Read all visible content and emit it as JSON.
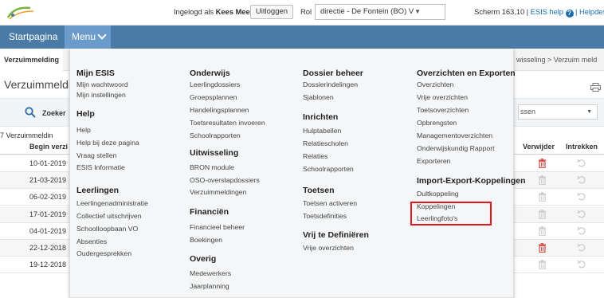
{
  "topbar": {
    "logged_in_prefix": "Ingelogd als",
    "user_name": "Kees Meester",
    "logout_label": "Uitloggen",
    "role_label": "Rol",
    "role_value": "directie - De Fontein (BO) V",
    "version": "Scherm 163.10 |",
    "esis_help": "ESIS help",
    "helpdesk": "| Helpdesk"
  },
  "nav": {
    "start": "Startpagina",
    "menu": "Menu"
  },
  "page": {
    "tab_label": "Verzuimmelding",
    "breadcrumb_right": "wisseling > Verzuim meld",
    "title": "Verzuimmeldi",
    "search_label": "Zoeker",
    "filter_value": "ssen",
    "count_text": "7 Verzuimmeldin",
    "columns": {
      "begin": "Begin verzi",
      "verwijder": "Verwijder",
      "intrekken": "Intrekken"
    },
    "rows": [
      {
        "date": "10-01-2019",
        "trash_active": true
      },
      {
        "date": "21-03-2019",
        "trash_active": false
      },
      {
        "date": "06-02-2019",
        "trash_active": false
      },
      {
        "date": "17-01-2019",
        "trash_active": false
      },
      {
        "date": "04-01-2019",
        "trash_active": false
      },
      {
        "date": "22-12-2018",
        "trash_active": true
      },
      {
        "date": "19-12-2018",
        "trash_active": false
      }
    ]
  },
  "megamenu": {
    "col1": {
      "sec1": {
        "title": "Mijn ESIS",
        "items": [
          "Mijn wachtwoord",
          "Mijn instellingen"
        ]
      },
      "sec2": {
        "title": "Help",
        "items": [
          "Help",
          "Help bij deze pagina",
          "Vraag stellen",
          "ESIS Informatie"
        ]
      },
      "sec3": {
        "title": "Leerlingen",
        "items": [
          "Leerlingenadministratie",
          "Collectief uitschrijven",
          "Schoolloopbaan VO",
          "Absenties",
          "Oudergesprekken"
        ]
      }
    },
    "col2": {
      "sec1": {
        "title": "Onderwijs",
        "items": [
          "Leerlingdossiers",
          "Groepsplannen",
          "Handelingsplannen",
          "Toetsresultaten invoeren",
          "Schoolrapporten"
        ]
      },
      "sec2": {
        "title": "Uitwisseling",
        "items": [
          "BRON module",
          "OSO-overstapdossiers",
          "Verzuimmeldingen"
        ]
      },
      "sec3": {
        "title": "Financiën",
        "items": [
          "Financieel beheer",
          "Boekingen"
        ]
      },
      "sec4": {
        "title": "Overig",
        "items": [
          "Medewerkers",
          "Jaarplanning"
        ]
      }
    },
    "col3": {
      "sec1": {
        "title": "Dossier beheer",
        "items": [
          "Dossierindelingen",
          "Sjablonen"
        ]
      },
      "sec2": {
        "title": "Inrichten",
        "items": [
          "Hulptabellen",
          "Relatiescholen",
          "Relaties",
          "Schoolrapporten"
        ]
      },
      "sec3": {
        "title": "Toetsen",
        "items": [
          "Toetsen activeren",
          "Toetsdefinities"
        ]
      },
      "sec4": {
        "title": "Vrij te Definiëren",
        "items": [
          "Vrije overzichten"
        ]
      }
    },
    "col4": {
      "sec1": {
        "title": "Overzichten en Exporten",
        "items": [
          "Overzichten",
          "Vrije overzichten",
          "Toetsoverzichten",
          "Opbrengsten",
          "Managementoverzichten",
          "Onderwijskundig Rapport",
          "Exporteren"
        ]
      },
      "sec2": {
        "title": "Import-Export-Koppelingen",
        "items": [
          "Dultkoppeling",
          "Koppelingen",
          "Leerlingfoto's"
        ]
      }
    }
  },
  "colors": {
    "navbar": "#4a7ba7",
    "menu_active": "#6b9bcb",
    "highlight": "#e0161e",
    "link": "#1a6fb0",
    "trash_active": "#d9534f"
  }
}
